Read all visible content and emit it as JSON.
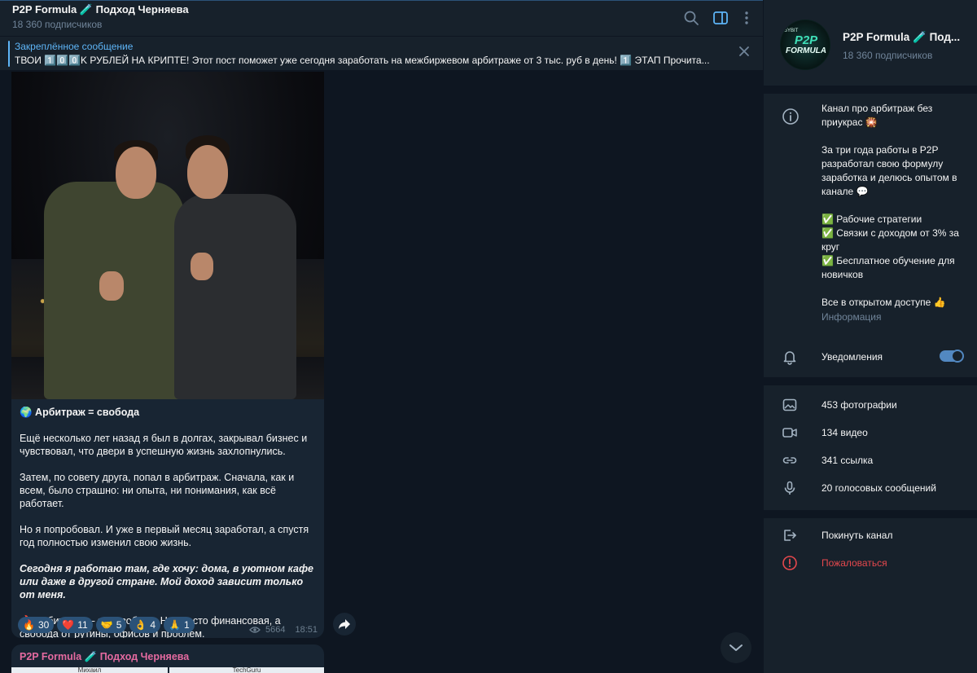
{
  "chat": {
    "title": "P2P Formula 🧪 Подход Черняева",
    "subscribers": "18 360 подписчиков",
    "pinned": {
      "label": "Закреплённое сообщение",
      "text": "ТВОИ 1️⃣0️⃣0️⃣K РУБЛЕЙ НА КРИПТЕ!  Этот пост поможет уже сегодня заработать на межбиржевом арбитраже от 3 тыс. руб в день!   1️⃣ ЭТАП Прочита..."
    },
    "post": {
      "caption_title": "🌍 Арбитраж = свобода",
      "paragraphs": [
        "Ещё несколько лет назад я был в долгах, закрывал бизнес и чувствовал, что двери в успешную жизнь захлопнулись.",
        "Затем, по совету друга, попал в арбитраж. Сначала, как и всем, было страшно: ни опыта, ни понимания, как всё работает.",
        "Но я попробовал. И уже в первый месяц заработал, а спустя год полностью изменил свою жизнь."
      ],
      "italic_paragraph": "Сегодня я работаю там, где хочу: дома, в уютном кафе или даже в другой стране. Мой доход зависит только от меня.",
      "closing": "🔥 Арбитраж — это свобода. Не просто финансовая, а свобода от рутины, офисов и проблем.",
      "reactions": [
        {
          "emoji": "🔥",
          "count": "30"
        },
        {
          "emoji": "❤️",
          "count": "11"
        },
        {
          "emoji": "🤝",
          "count": "5"
        },
        {
          "emoji": "👌",
          "count": "4"
        },
        {
          "emoji": "🙏",
          "count": "1"
        }
      ],
      "views": "5664",
      "time": "18:51"
    },
    "next_post": {
      "author": "P2P Formula 🧪 Подход Черняева",
      "thumb_labels": [
        "Михаил",
        "TechGuru"
      ]
    }
  },
  "info": {
    "name": "P2P Formula 🧪 Под...",
    "subscribers": "18 360 подписчиков",
    "avatar": {
      "small": "BYBIT",
      "big": "P2P",
      "sub": "FORMULA"
    },
    "about": [
      "Канал про арбитраж без приукрас 🎇",
      "За три года работы в P2P разработал свою формулу заработка и делюсь опытом в канале 💬"
    ],
    "features": [
      "✅ Рабочие стратегии",
      "✅ Связки с доходом от 3% за круг",
      "✅ Бесплатное обучение для новичков"
    ],
    "about_last": "Все в открытом доступе 👍",
    "about_label": "Информация",
    "notifications_label": "Уведомления",
    "notifications_on": true,
    "media": {
      "photos": "453 фотографии",
      "videos": "134 видео",
      "links": "341 ссылка",
      "voice": "20 голосовых сообщений"
    },
    "leave": "Покинуть канал",
    "report": "Пожаловаться"
  },
  "colors": {
    "bg": "#0e1621",
    "panel": "#17212b",
    "bubble": "#182533",
    "accent": "#5eb5f7",
    "danger": "#e5484d",
    "muted": "#708499"
  }
}
